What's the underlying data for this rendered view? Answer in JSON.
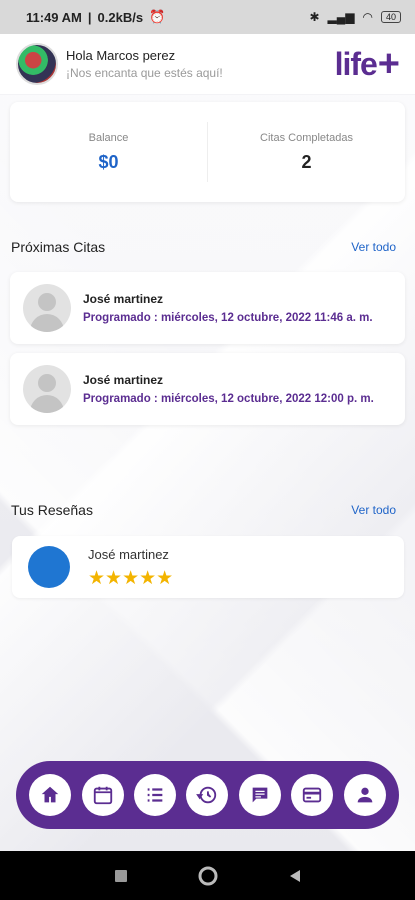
{
  "status_bar": {
    "time": "11:49 AM",
    "speed": "0.2kB/s",
    "battery": "40"
  },
  "header": {
    "greeting": "Hola Marcos perez",
    "subtitle": "¡Nos encanta que estés aquí!",
    "logo_text": "life",
    "logo_plus": "+"
  },
  "stats": {
    "balance_label": "Balance",
    "balance_value": "$0",
    "completed_label": "Citas Completadas",
    "completed_value": "2"
  },
  "upcoming": {
    "title": "Próximas Citas",
    "see_all": "Ver todo",
    "items": [
      {
        "name": "José martinez",
        "when": "Programado : miércoles, 12 octubre, 2022 11:46 a. m."
      },
      {
        "name": "José martinez",
        "when": "Programado : miércoles, 12 octubre, 2022 12:00 p. m."
      }
    ]
  },
  "reviews": {
    "title": "Tus Reseñas",
    "see_all": "Ver todo",
    "items": [
      {
        "name": "José martinez",
        "stars": "★★★★★",
        "rating": 5
      }
    ]
  },
  "nav": {
    "icons": [
      "home-icon",
      "calendar-icon",
      "list-icon",
      "history-icon",
      "chat-icon",
      "card-icon",
      "user-icon"
    ]
  },
  "colors": {
    "brand": "#5b2d91",
    "accent": "#1f64c8",
    "star": "#f3b400"
  }
}
